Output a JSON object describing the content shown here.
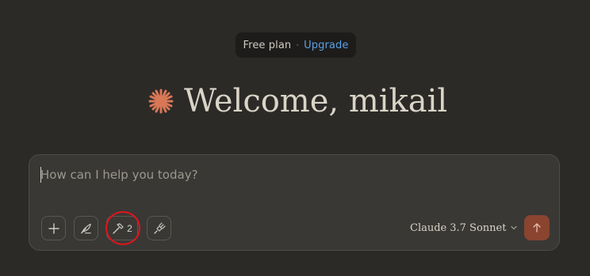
{
  "plan": {
    "label": "Free plan",
    "separator": "·",
    "upgrade_label": "Upgrade"
  },
  "welcome": {
    "icon": "claude-spark-icon",
    "text": "Welcome, mikail"
  },
  "composer": {
    "placeholder": "How can I help you today?",
    "value": "",
    "buttons": {
      "add_icon": "plus-icon",
      "style_icon": "feather-pen-icon",
      "tools_icon": "hammer-icon",
      "tools_count": "2",
      "connect_icon": "plug-icon",
      "send_icon": "arrow-up-icon"
    },
    "model": {
      "name": "Claude",
      "version": "3.7 Sonnet",
      "chevron_icon": "chevron-down-icon"
    }
  },
  "colors": {
    "background": "#2b2a27",
    "accent": "#d97757",
    "send_button": "#8a4430",
    "link": "#5aa0e6",
    "highlight_ring": "#e0141b"
  }
}
